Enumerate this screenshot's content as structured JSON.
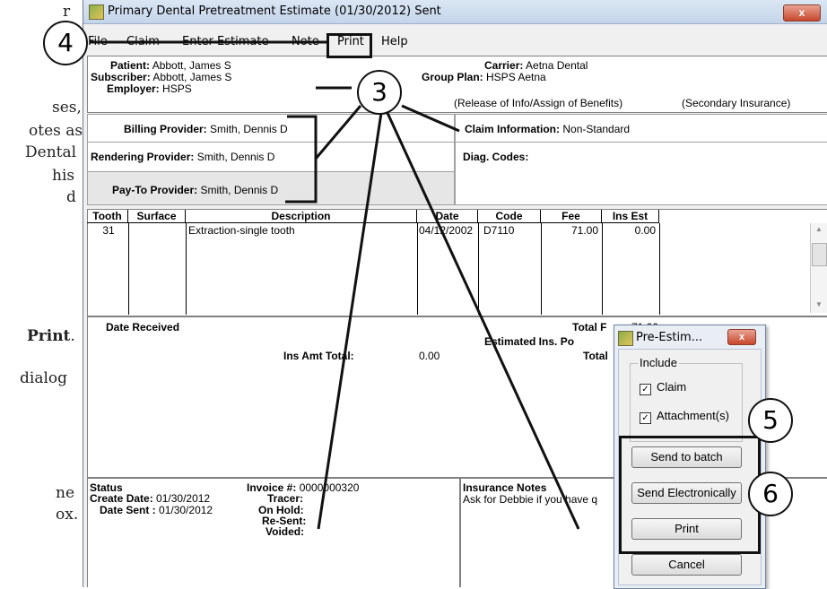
{
  "doc_text": {
    "line1": "r",
    "line2": "ses,",
    "line3": "otes as",
    "line4": " Dental",
    "line5": "his",
    "line6": "d",
    "line7": "Print",
    "line7_suffix": ".",
    "line8": " dialog",
    "line9": "ne",
    "line10": "ox."
  },
  "window": {
    "title": "Primary Dental Pretreatment Estimate (01/30/2012) Sent",
    "close_label": "x"
  },
  "menu": [
    "File",
    "Claim",
    "Enter Estimate",
    "Note",
    "Print",
    "Help"
  ],
  "header": {
    "patient_label": "Patient:",
    "patient_value": "Abbott, James S",
    "subscriber_label": "Subscriber:",
    "subscriber_value": "Abbott, James S",
    "employer_label": "Employer:",
    "employer_value": "HSPS",
    "carrier_label": "Carrier:",
    "carrier_value": "Aetna Dental",
    "group_plan_label": "Group Plan:",
    "group_plan_value": "HSPS Aetna",
    "release_text": "(Release of Info/Assign of Benefits)",
    "secondary_text": "(Secondary Insurance)"
  },
  "providers": {
    "billing_label": "Billing Provider:",
    "billing_value": "Smith, Dennis D",
    "rendering_label": "Rendering Provider:",
    "rendering_value": "Smith, Dennis D",
    "payto_label": "Pay-To Provider:",
    "payto_value": "Smith, Dennis D",
    "claim_info_label": "Claim Information:",
    "claim_info_value": "Non-Standard",
    "diag_label": "Diag. Codes:"
  },
  "table": {
    "columns": [
      "Tooth",
      "Surface",
      "Description",
      "Date",
      "Code",
      "Fee",
      "Ins Est"
    ],
    "rows": [
      {
        "tooth": "31",
        "surface": "",
        "description": "Extraction-single tooth",
        "date": "04/12/2002",
        "code": "D7110",
        "fee": "71.00",
        "ins_est": "0.00"
      }
    ]
  },
  "totals": {
    "date_received_label": "Date Received",
    "ins_amt_total_label": "Ins Amt Total:",
    "ins_amt_total_value": "0.00",
    "total_fee_label": "Total F",
    "total_fee_value": "71.00",
    "estimated_label": "Estimated Ins. Po",
    "total_label": "Total"
  },
  "status": {
    "status_label": "Status",
    "create_label": "Create Date:",
    "create_value": "01/30/2012",
    "sent_label": "Date Sent :",
    "sent_value": "01/30/2012",
    "invoice_label": "Invoice #:",
    "invoice_value": "0000000320",
    "tracer_label": "Tracer:",
    "onhold_label": "On Hold:",
    "resent_label": "Re-Sent:",
    "voided_label": "Voided:",
    "ins_notes_label": "Insurance Notes",
    "ins_notes_value": "Ask for Debbie if you have q"
  },
  "dialog": {
    "title": "Pre-Estim...",
    "close_label": "x",
    "include_label": "Include",
    "claim_label": "Claim",
    "attachment_label": "Attachment(s)",
    "check_mark": "✓",
    "buttons": [
      "Send to batch",
      "Send Electronically",
      "Print",
      "Cancel"
    ]
  },
  "callouts": [
    "3",
    "4",
    "5",
    "6"
  ]
}
